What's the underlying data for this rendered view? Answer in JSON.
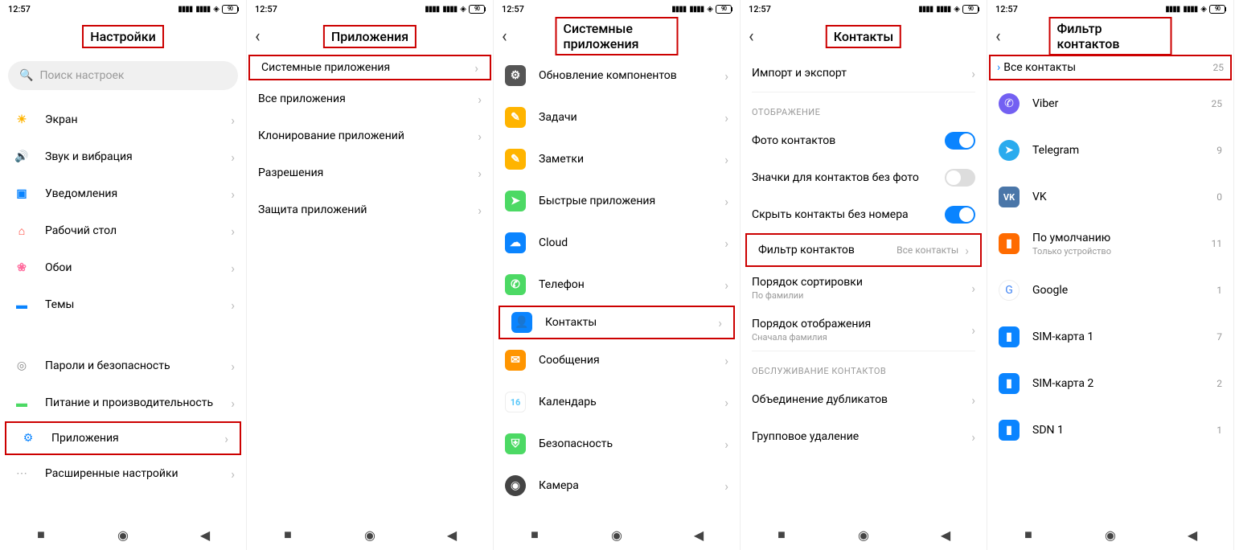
{
  "time": "12:57",
  "battery": "90",
  "screen1": {
    "title": "Настройки",
    "search_placeholder": "Поиск настроек",
    "items": [
      {
        "label": "Экран",
        "color": "#ffb400"
      },
      {
        "label": "Звук и вибрация",
        "color": "#4cd964"
      },
      {
        "label": "Уведомления",
        "color": "#0a84ff"
      },
      {
        "label": "Рабочий стол",
        "color": "#ff3b30"
      },
      {
        "label": "Обои",
        "color": "#ff6b9d"
      },
      {
        "label": "Темы",
        "color": "#0a84ff"
      }
    ],
    "items2": [
      {
        "label": "Пароли и безопасность",
        "color": "#888"
      },
      {
        "label": "Питание и производительность",
        "color": "#4cd964"
      },
      {
        "label": "Приложения",
        "color": "#0a84ff",
        "highlight": true
      },
      {
        "label": "Расширенные настройки",
        "color": "#aaa"
      }
    ]
  },
  "screen2": {
    "title": "Приложения",
    "items": [
      {
        "label": "Системные приложения",
        "highlight": true
      },
      {
        "label": "Все приложения"
      },
      {
        "label": "Клонирование приложений"
      },
      {
        "label": "Разрешения"
      },
      {
        "label": "Защита приложений"
      }
    ]
  },
  "screen3": {
    "title": "Системные приложения",
    "items": [
      {
        "label": "Обновление компонентов",
        "color": "#555"
      },
      {
        "label": "Задачи",
        "color": "#ffb400"
      },
      {
        "label": "Заметки",
        "color": "#ffb400"
      },
      {
        "label": "Быстрые приложения",
        "color": "#4cd964"
      },
      {
        "label": "Cloud",
        "color": "#0a84ff"
      },
      {
        "label": "Телефон",
        "color": "#4cd964"
      },
      {
        "label": "Контакты",
        "color": "#0a84ff",
        "highlight": true
      },
      {
        "label": "Сообщения",
        "color": "#ff9500"
      },
      {
        "label": "Календарь",
        "color": "#5ac8fa",
        "text": "16"
      },
      {
        "label": "Безопасность",
        "color": "#4cd964"
      },
      {
        "label": "Камера",
        "color": "#444",
        "round": true
      }
    ]
  },
  "screen4": {
    "title": "Контакты",
    "first_item": {
      "label": "Импорт и экспорт"
    },
    "section1": "ОТОБРАЖЕНИЕ",
    "toggles": [
      {
        "label": "Фото контактов",
        "on": true
      },
      {
        "label": "Значки для контактов без фото",
        "on": false
      },
      {
        "label": "Скрыть контакты без номера",
        "on": true
      }
    ],
    "filter": {
      "label": "Фильтр контактов",
      "value": "Все контакты",
      "highlight": true
    },
    "sort": {
      "label": "Порядок сортировки",
      "sub": "По фамилии"
    },
    "display_order": {
      "label": "Порядок отображения",
      "sub": "Сначала фамилия"
    },
    "section2": "ОБСЛУЖИВАНИЕ КОНТАКТОВ",
    "maintenance": [
      {
        "label": "Объединение дубликатов"
      },
      {
        "label": "Групповое удаление"
      }
    ]
  },
  "screen5": {
    "title": "Фильтр контактов",
    "items": [
      {
        "label": "Все контакты",
        "count": "25",
        "selected": true,
        "highlight": true
      },
      {
        "label": "Viber",
        "count": "25",
        "color": "#7360f2",
        "round": true
      },
      {
        "label": "Telegram",
        "count": "9",
        "color": "#2aabee",
        "round": true
      },
      {
        "label": "VK",
        "count": "0",
        "color": "#4a76a8"
      },
      {
        "label": "По умолчанию",
        "sub": "Только устройство",
        "count": "11",
        "color": "#ff6b00"
      },
      {
        "label": "Google",
        "count": "1",
        "color": "#fff",
        "text": "G",
        "gborder": true,
        "round": true
      },
      {
        "label": "SIM-карта 1",
        "count": "7",
        "color": "#0a84ff"
      },
      {
        "label": "SIM-карта 2",
        "count": "2",
        "color": "#0a84ff"
      },
      {
        "label": "SDN 1",
        "count": "1",
        "color": "#0a84ff"
      }
    ]
  }
}
